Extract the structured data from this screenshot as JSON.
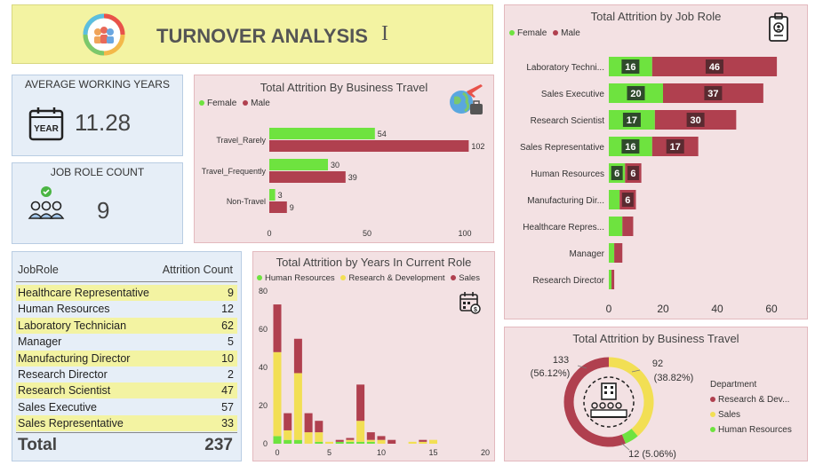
{
  "header": {
    "title": "TURNOVER ANALYSIS",
    "icon": "team-icon"
  },
  "cards": {
    "avg_years": {
      "label": "AVERAGE WORKING YEARS",
      "value": "11.28",
      "icon": "calendar-year-icon",
      "icon_text": "YEAR"
    },
    "job_roles": {
      "label": "JOB ROLE COUNT",
      "value": "9",
      "icon": "people-check-icon"
    }
  },
  "colors": {
    "female": "#6ee33f",
    "male": "#b0404f",
    "hr": "#6ee33f",
    "rd": "#f2df54",
    "sales": "#b0404f"
  },
  "table": {
    "col1": "JobRole",
    "col2": "Attrition Count",
    "rows": [
      {
        "role": "Healthcare Representative",
        "count": "9"
      },
      {
        "role": "Human Resources",
        "count": "12"
      },
      {
        "role": "Laboratory Technician",
        "count": "62"
      },
      {
        "role": "Manager",
        "count": "5"
      },
      {
        "role": "Manufacturing Director",
        "count": "10"
      },
      {
        "role": "Research Director",
        "count": "2"
      },
      {
        "role": "Research Scientist",
        "count": "47"
      },
      {
        "role": "Sales Executive",
        "count": "57"
      },
      {
        "role": "Sales Representative",
        "count": "33"
      }
    ],
    "total_label": "Total",
    "total_value": "237"
  },
  "chart_data": [
    {
      "id": "travel_bar",
      "type": "bar",
      "title": "Total Attrition By Business Travel",
      "categories": [
        "Travel_Rarely",
        "Travel_Frequently",
        "Non-Travel"
      ],
      "series": [
        {
          "name": "Female",
          "values": [
            54,
            30,
            3
          ]
        },
        {
          "name": "Male",
          "values": [
            102,
            39,
            9
          ]
        }
      ],
      "xlim": [
        0,
        110
      ],
      "xticks": [
        "0",
        "50",
        "100"
      ],
      "orientation": "horizontal",
      "legend": "top-left"
    },
    {
      "id": "years_role",
      "type": "bar",
      "title": "Total Attrition by Years In Current Role",
      "x": [
        0,
        1,
        2,
        3,
        4,
        5,
        6,
        7,
        8,
        9,
        10,
        11,
        13,
        14,
        15
      ],
      "series": [
        {
          "name": "Human Resources",
          "values": [
            4,
            2,
            2,
            0,
            1,
            0,
            1,
            1,
            1,
            1,
            0,
            0,
            0,
            0,
            0
          ]
        },
        {
          "name": "Research & Development",
          "values": [
            44,
            5,
            35,
            6,
            5,
            1,
            0,
            1,
            11,
            1,
            2,
            0,
            1,
            1,
            2
          ]
        },
        {
          "name": "Sales",
          "values": [
            25,
            9,
            18,
            10,
            6,
            0,
            1,
            1,
            19,
            4,
            2,
            2,
            0,
            1,
            0
          ]
        }
      ],
      "stacked": true,
      "ylim": [
        0,
        80
      ],
      "yticks": [
        "0",
        "20",
        "40",
        "60",
        "80"
      ],
      "xlim": [
        -1,
        20
      ],
      "xticks": [
        "0",
        "5",
        "10",
        "15",
        "20"
      ],
      "legend": "top-left"
    },
    {
      "id": "job_role",
      "type": "bar",
      "title": "Total Attrition by Job Role",
      "categories": [
        "Laboratory Techni...",
        "Sales Executive",
        "Research Scientist",
        "Sales Representative",
        "Human Resources",
        "Manufacturing Dir...",
        "Healthcare Repres...",
        "Manager",
        "Research Director"
      ],
      "series": [
        {
          "name": "Female",
          "values": [
            16,
            20,
            17,
            16,
            6,
            4,
            5,
            2,
            1
          ]
        },
        {
          "name": "Male",
          "values": [
            46,
            37,
            30,
            17,
            6,
            6,
            4,
            3,
            1
          ]
        }
      ],
      "data_labels": {
        "Female": [
          "16",
          "20",
          "17",
          "16",
          "6",
          "",
          "",
          "",
          ""
        ],
        "Male": [
          "46",
          "37",
          "30",
          "17",
          "6",
          "6",
          "",
          "",
          ""
        ]
      },
      "stacked": true,
      "orientation": "horizontal",
      "xlim": [
        0,
        65
      ],
      "xticks": [
        "0",
        "20",
        "40",
        "60"
      ],
      "legend": "top-left"
    },
    {
      "id": "travel_donut",
      "type": "pie",
      "title": "Total Attrition by Business Travel",
      "legend_title": "Department",
      "slices": [
        {
          "name": "Research & Dev...",
          "value": 133,
          "label": "133",
          "pct": "(56.12%)"
        },
        {
          "name": "Sales",
          "value": 92,
          "label": "92",
          "pct": "(38.82%)"
        },
        {
          "name": "Human Resources",
          "value": 12,
          "label": "12 (5.06%)",
          "pct": ""
        }
      ],
      "legend": "right"
    }
  ]
}
